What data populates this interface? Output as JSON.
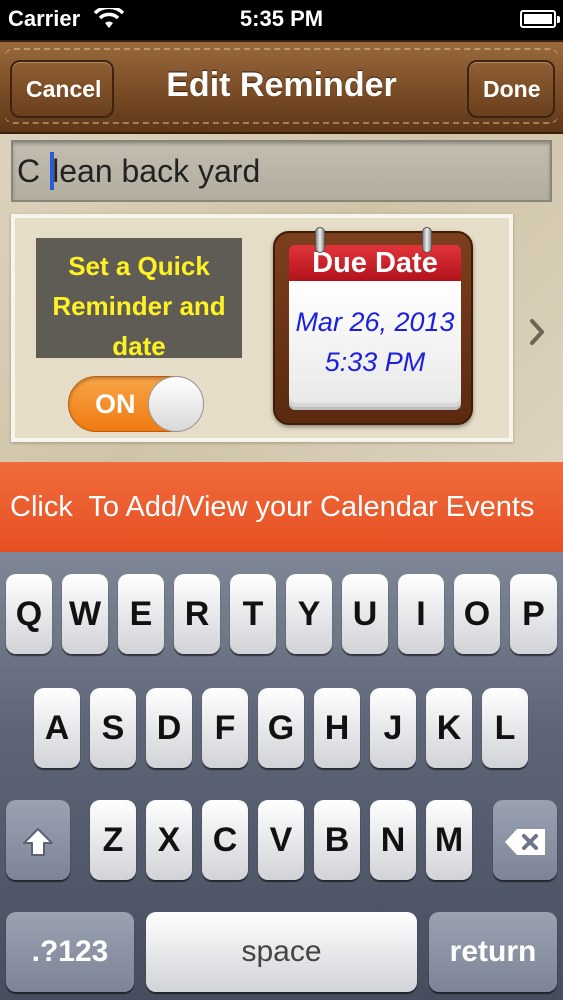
{
  "status_bar": {
    "carrier": "Carrier",
    "time": "5:35 PM"
  },
  "nav": {
    "cancel_label": "Cancel",
    "title": "Edit Reminder",
    "done_label": "Done"
  },
  "reminder": {
    "first_char": "C",
    "rest_text": "lean back yard"
  },
  "quick_reminder": {
    "label_lines": [
      "Set a Quick",
      "Reminder and",
      "date"
    ],
    "toggle_label": "ON",
    "toggle_on": true
  },
  "due_date": {
    "header": "Due Date",
    "date": "Mar 26, 2013",
    "time": "5:33 PM"
  },
  "events_bar": {
    "label": "Click  To Add/View your Calendar Events"
  },
  "keyboard": {
    "row1": [
      "Q",
      "W",
      "E",
      "R",
      "T",
      "Y",
      "U",
      "I",
      "O",
      "P"
    ],
    "row2": [
      "A",
      "S",
      "D",
      "F",
      "G",
      "H",
      "J",
      "K",
      "L"
    ],
    "row3": [
      "Z",
      "X",
      "C",
      "V",
      "B",
      "N",
      "M"
    ],
    "numbers_label": ".?123",
    "space_label": "space",
    "return_label": "return"
  },
  "colors": {
    "accent_orange": "#e85a2b",
    "toggle_orange": "#f28a25",
    "quick_label_text": "#fff224",
    "due_date_text": "#1a1fe0"
  },
  "icons": [
    "wifi-icon",
    "battery-icon",
    "chevron-right-icon",
    "shift-icon",
    "backspace-icon"
  ]
}
